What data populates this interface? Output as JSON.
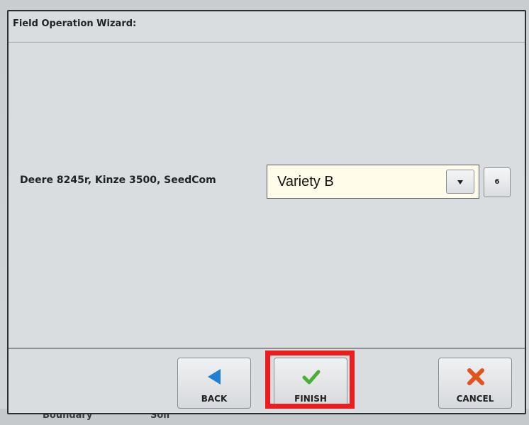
{
  "dialog": {
    "title": "Field Operation Wizard:"
  },
  "operation": {
    "label": "Deere 8245r, Kinze 3500, SeedCom",
    "dropdown_value": "Variety B",
    "side_button_label": "6"
  },
  "buttons": {
    "back": "BACK",
    "finish": "FINISH",
    "cancel": "CANCEL"
  },
  "background": {
    "strip_left": "Boundary",
    "strip_right": "Soil"
  },
  "colors": {
    "highlight": "#ee1c1c",
    "back_icon": "#1f7fd6",
    "finish_icon": "#4caf35",
    "cancel_icon": "#e2541a"
  }
}
